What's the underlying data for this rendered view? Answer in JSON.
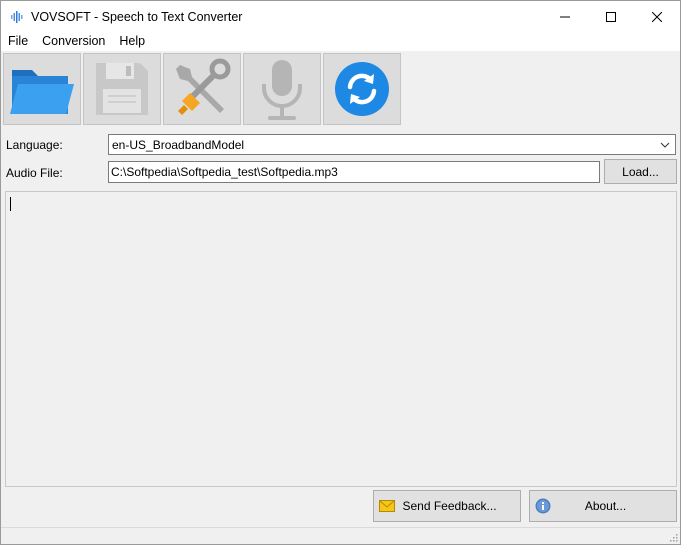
{
  "window": {
    "title": "VOVSOFT - Speech to Text Converter"
  },
  "menu": {
    "items": [
      "File",
      "Conversion",
      "Help"
    ]
  },
  "toolbar": {
    "buttons": [
      {
        "icon": "folder-open-icon"
      },
      {
        "icon": "floppy-disk-icon"
      },
      {
        "icon": "tools-icon"
      },
      {
        "icon": "microphone-icon"
      },
      {
        "icon": "refresh-icon"
      }
    ]
  },
  "form": {
    "language_label": "Language:",
    "language_value": "en-US_BroadbandModel",
    "audio_label": "Audio File:",
    "audio_value": "C:\\Softpedia\\Softpedia_test\\Softpedia.mp3",
    "load_label": "Load..."
  },
  "footer": {
    "feedback_label": "Send Feedback...",
    "about_label": "About..."
  },
  "colors": {
    "accent_blue": "#1e88e5",
    "folder_blue": "#2f8fdc",
    "tool_orange": "#f5a623"
  }
}
